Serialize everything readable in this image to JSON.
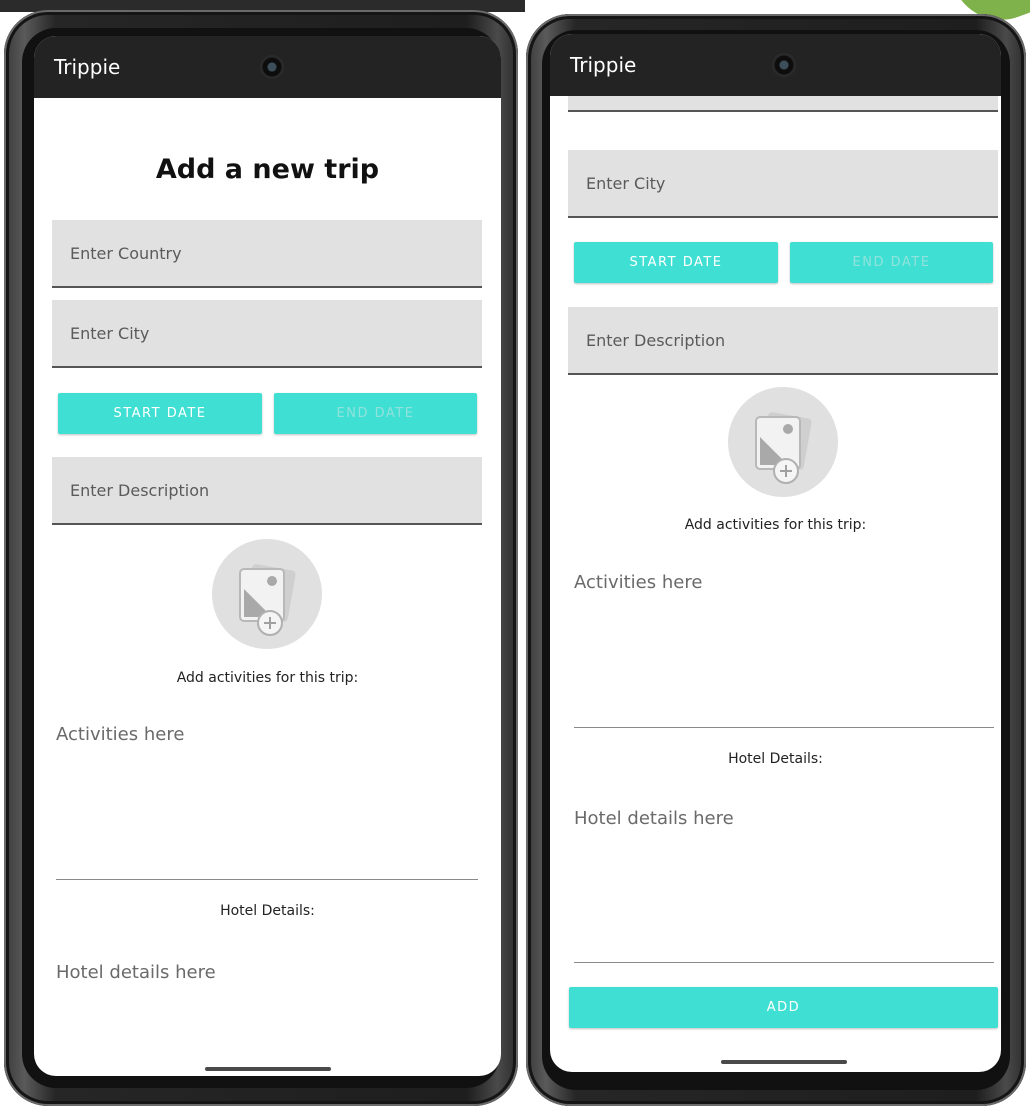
{
  "app": {
    "title": "Trippie"
  },
  "form": {
    "heading": "Add a new trip",
    "country_placeholder": "Enter Country",
    "city_placeholder": "Enter City",
    "start_date_label": "START DATE",
    "end_date_label": "END DATE",
    "description_placeholder": "Enter Description",
    "activities_label": "Add activities for this trip:",
    "activities_placeholder": "Activities here",
    "hotel_label": "Hotel Details:",
    "hotel_placeholder": "Hotel details here",
    "add_label": "ADD"
  },
  "icons": {
    "image_picker": "add-photo-icon",
    "camera": "front-camera-icon"
  },
  "colors": {
    "accent": "#40dfd3",
    "appbar": "#232323",
    "field_bg": "#e1e1e1"
  }
}
